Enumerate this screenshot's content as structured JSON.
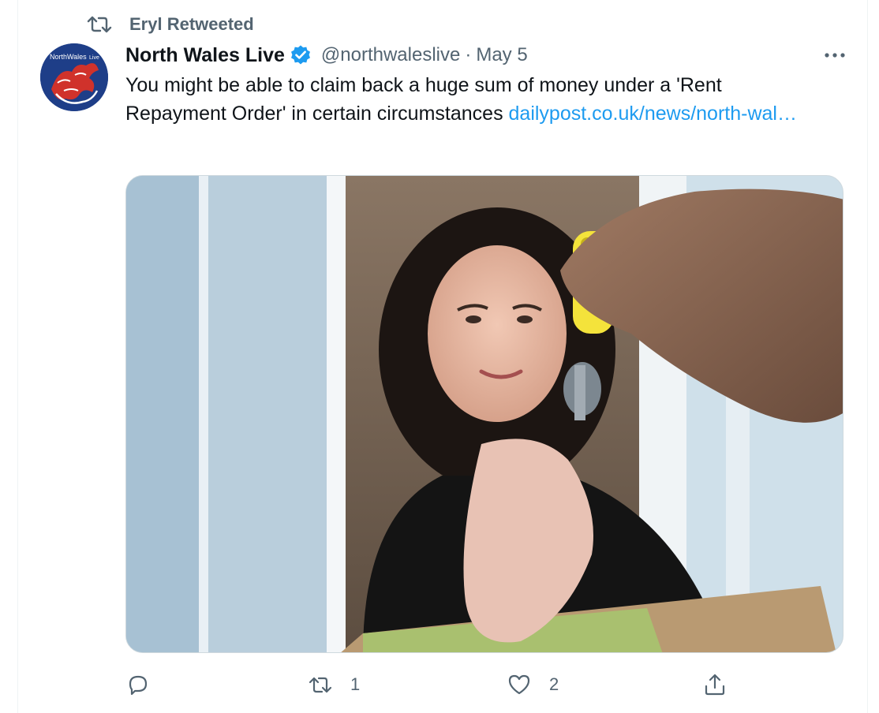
{
  "retweet": {
    "icon": "retweet-icon",
    "label": "Eryl Retweeted"
  },
  "author": {
    "avatar_text": "NorthWales",
    "avatar_text_small": "Live",
    "name": "North Wales Live",
    "verified_icon": "verified-badge-icon",
    "handle": "@northwaleslive",
    "separator": "·",
    "date": "May 5"
  },
  "tweet": {
    "text": "You might be able to claim back a huge sum of money under a 'Rent Repayment Order' in certain circumstances ",
    "link": "dailypost.co.uk/news/north-wal…",
    "media_icon": "photo-woman-receiving-keys"
  },
  "actions": {
    "reply": {
      "icon": "reply-icon",
      "count": ""
    },
    "retweet": {
      "icon": "retweet-icon",
      "count": "1"
    },
    "like": {
      "icon": "heart-icon",
      "count": "2"
    },
    "share": {
      "icon": "share-icon",
      "count": ""
    }
  },
  "colors": {
    "text_primary": "#0f1419",
    "text_secondary": "#536471",
    "link": "#1d9bf0",
    "verified": "#1d9bf0"
  }
}
